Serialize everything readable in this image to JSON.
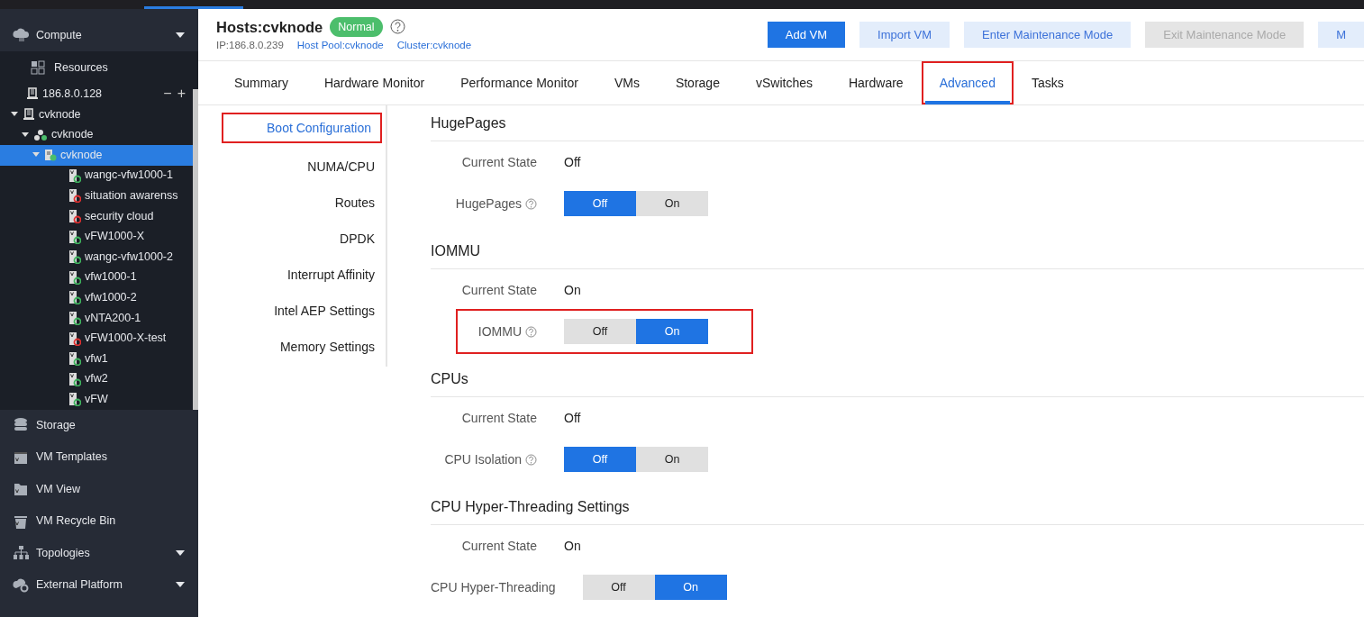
{
  "sidebar": {
    "sections_top": [
      {
        "label": "Compute",
        "expanded": true
      }
    ],
    "resources": {
      "label": "Resources"
    },
    "tree": [
      {
        "label": "186.8.0.128",
        "kind": "server"
      },
      {
        "label": "cvknode",
        "kind": "server",
        "expanded": true,
        "children": [
          {
            "label": "cvknode",
            "kind": "cluster",
            "expanded": true,
            "children": [
              {
                "label": "cvknode",
                "kind": "host",
                "expanded": true,
                "selected": true,
                "children": [
                  {
                    "label": "wangc-vfw1000-1",
                    "kind": "vm",
                    "running": true,
                    "selected": false
                  },
                  {
                    "label": "situation awarenss",
                    "kind": "vm",
                    "running": false,
                    "selected": false
                  },
                  {
                    "label": "security cloud",
                    "kind": "vm",
                    "running": false,
                    "selected": false
                  },
                  {
                    "label": "vFW1000-X",
                    "kind": "vm",
                    "running": true,
                    "selected": false
                  },
                  {
                    "label": "wangc-vfw1000-2",
                    "kind": "vm",
                    "running": true,
                    "selected": false
                  },
                  {
                    "label": "vfw1000-1",
                    "kind": "vm",
                    "running": true,
                    "selected": false
                  },
                  {
                    "label": "vfw1000-2",
                    "kind": "vm",
                    "running": true,
                    "selected": false
                  },
                  {
                    "label": "vNTA200-1",
                    "kind": "vm",
                    "running": true,
                    "selected": false
                  },
                  {
                    "label": "vFW1000-X-test",
                    "kind": "vm",
                    "running": false,
                    "selected": false
                  },
                  {
                    "label": "vfw1",
                    "kind": "vm",
                    "running": true,
                    "selected": false
                  },
                  {
                    "label": "vfw2",
                    "kind": "vm",
                    "running": true,
                    "selected": false
                  },
                  {
                    "label": "vFW",
                    "kind": "vm",
                    "running": true,
                    "selected": false
                  }
                ]
              }
            ]
          }
        ]
      }
    ],
    "tree_actions": [
      "−",
      "+"
    ],
    "sections": [
      {
        "label": "Storage",
        "has_caret": false
      },
      {
        "label": "VM Templates",
        "has_caret": false
      },
      {
        "label": "VM View",
        "has_caret": false
      },
      {
        "label": "VM Recycle Bin",
        "has_caret": false
      },
      {
        "label": "Topologies",
        "has_caret": true
      },
      {
        "label": "External Platform",
        "has_caret": true
      }
    ]
  },
  "header": {
    "title": "Hosts:cvknode",
    "status": "Normal",
    "ip": "IP:186.8.0.239",
    "links": [
      "Host Pool:cvknode",
      "Cluster:cvknode"
    ]
  },
  "actions": [
    {
      "label": "Add VM",
      "kind": "primary"
    },
    {
      "label": "Import VM",
      "kind": "light"
    },
    {
      "label": "Enter Maintenance Mode",
      "kind": "light"
    },
    {
      "label": "Exit Maintenance Mode",
      "kind": "disabled"
    },
    {
      "label": "M",
      "kind": "light"
    }
  ],
  "tabs": [
    {
      "label": "Summary",
      "selected": false,
      "highlighted": false
    },
    {
      "label": "Hardware Monitor",
      "selected": false,
      "highlighted": false
    },
    {
      "label": "Performance Monitor",
      "selected": false,
      "highlighted": false
    },
    {
      "label": "VMs",
      "selected": false,
      "highlighted": false
    },
    {
      "label": "Storage",
      "selected": false,
      "highlighted": false
    },
    {
      "label": "vSwitches",
      "selected": false,
      "highlighted": false
    },
    {
      "label": "Hardware",
      "selected": false,
      "highlighted": false
    },
    {
      "label": "Advanced",
      "selected": true,
      "highlighted": true
    },
    {
      "label": "Tasks",
      "selected": false,
      "highlighted": false
    }
  ],
  "submenu": [
    {
      "label": "Boot Configuration",
      "selected": true,
      "highlighted": true
    },
    {
      "label": "NUMA/CPU",
      "selected": false,
      "highlighted": false
    },
    {
      "label": "Routes",
      "selected": false,
      "highlighted": false
    },
    {
      "label": "DPDK",
      "selected": false,
      "highlighted": false
    },
    {
      "label": "Interrupt Affinity",
      "selected": false,
      "highlighted": false
    },
    {
      "label": "Intel AEP Settings",
      "selected": false,
      "highlighted": false
    },
    {
      "label": "Memory Settings",
      "selected": false,
      "highlighted": false
    }
  ],
  "settings": [
    {
      "title": "HugePages",
      "state_label": "Current State",
      "state": "Off",
      "toggle_label": "HugePages",
      "help": true,
      "options": [
        "Off",
        "On"
      ],
      "on": false,
      "highlighted": false
    },
    {
      "title": "IOMMU",
      "state_label": "Current State",
      "state": "On",
      "toggle_label": "IOMMU",
      "help": true,
      "options": [
        "Off",
        "On"
      ],
      "on": true,
      "highlighted": true
    },
    {
      "title": "CPUs",
      "state_label": "Current State",
      "state": "Off",
      "toggle_label": "CPU Isolation",
      "help": true,
      "options": [
        "Off",
        "On"
      ],
      "on": false,
      "highlighted": false
    },
    {
      "title": "CPU Hyper-Threading Settings",
      "state_label": "Current State",
      "state": "On",
      "toggle_label": "CPU Hyper-Threading",
      "help": false,
      "options": [
        "Off",
        "On"
      ],
      "on": true,
      "highlighted": false
    }
  ]
}
